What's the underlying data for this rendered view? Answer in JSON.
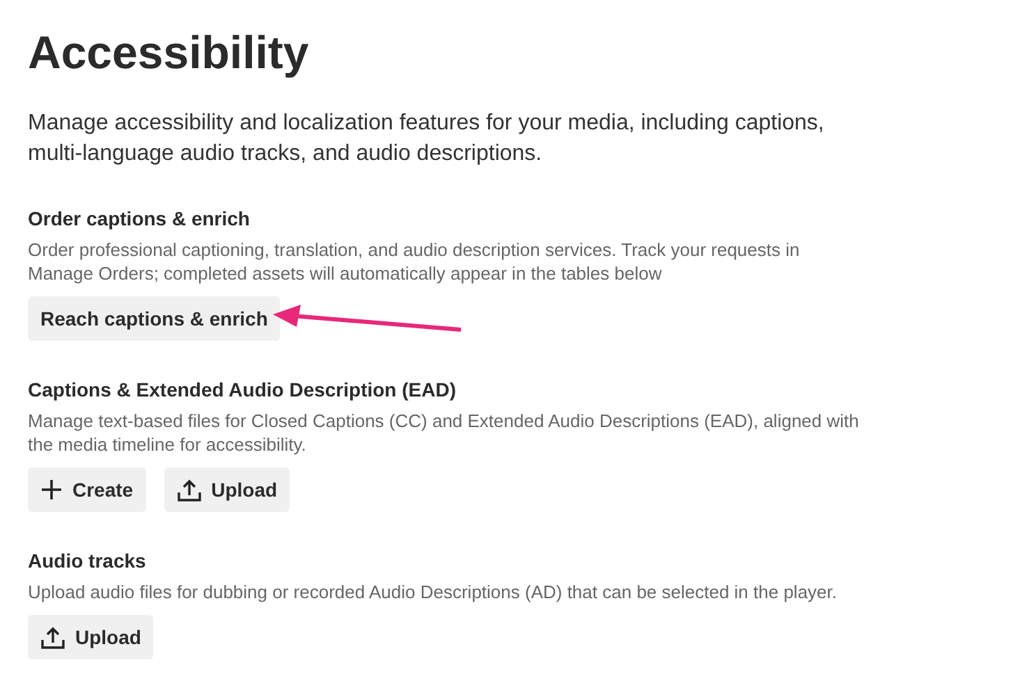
{
  "title": "Accessibility",
  "intro": "Manage accessibility and localization features for your media, including captions, multi-language audio tracks, and audio descriptions.",
  "sections": [
    {
      "heading": "Order captions & enrich",
      "description": "Order professional captioning, translation, and audio description services. Track your requests in Manage Orders; completed assets will automatically appear in the tables below",
      "buttons": [
        {
          "label": "Reach captions & enrich",
          "kind": "plain",
          "annotated": true
        }
      ]
    },
    {
      "heading": "Captions & Extended Audio Description (EAD)",
      "description": "Manage text-based files for Closed Captions (CC) and Extended Audio Descriptions (EAD), aligned with the media timeline for accessibility.",
      "buttons": [
        {
          "label": "Create",
          "kind": "plus",
          "annotated": false
        },
        {
          "label": "Upload",
          "kind": "upload",
          "annotated": false
        }
      ]
    },
    {
      "heading": "Audio tracks",
      "description": "Upload audio files for dubbing or recorded Audio Descriptions (AD) that can be selected in the player.",
      "buttons": [
        {
          "label": "Upload",
          "kind": "upload",
          "annotated": false
        }
      ]
    }
  ]
}
